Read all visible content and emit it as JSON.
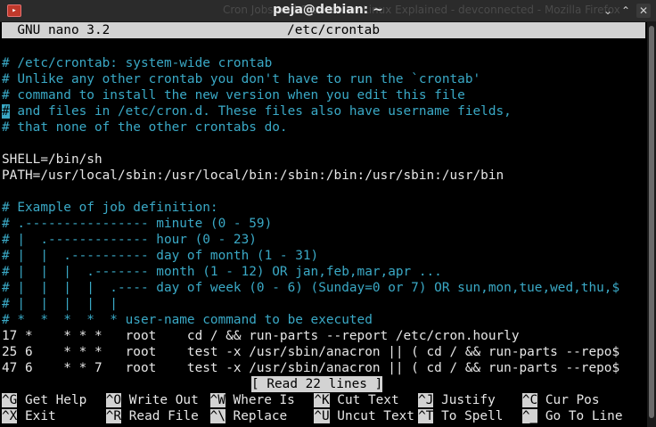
{
  "window": {
    "title": "peja@debian: ~",
    "background_title": "Cron Jobs and Crontab on Linux Explained - devconnected - Mozilla Firefox",
    "buttons": [
      "minimize",
      "maximize",
      "close"
    ]
  },
  "editor": {
    "app_name": "GNU nano 3.2",
    "file_name": "/etc/crontab",
    "status_message": "[ Read 22 lines ]",
    "lines": [
      {
        "text": "",
        "kind": "txt"
      },
      {
        "text": "# /etc/crontab: system-wide crontab",
        "kind": "cmt"
      },
      {
        "text": "# Unlike any other crontab you don't have to run the `crontab'",
        "kind": "cmt"
      },
      {
        "text": "# command to install the new version when you edit this file",
        "kind": "cmt"
      },
      {
        "text": "# and files in /etc/cron.d. These files also have username fields,",
        "kind": "cmt"
      },
      {
        "text": "# that none of the other crontabs do.",
        "kind": "cmt"
      },
      {
        "text": "",
        "kind": "txt"
      },
      {
        "text": "SHELL=/bin/sh",
        "kind": "txt"
      },
      {
        "text": "PATH=/usr/local/sbin:/usr/local/bin:/sbin:/bin:/usr/sbin:/usr/bin",
        "kind": "txt"
      },
      {
        "text": "",
        "kind": "txt"
      },
      {
        "text": "# Example of job definition:",
        "kind": "cmt"
      },
      {
        "text": "# .---------------- minute (0 - 59)",
        "kind": "cmt"
      },
      {
        "text": "# |  .------------- hour (0 - 23)",
        "kind": "cmt"
      },
      {
        "text": "# |  |  .---------- day of month (1 - 31)",
        "kind": "cmt"
      },
      {
        "text": "# |  |  |  .------- month (1 - 12) OR jan,feb,mar,apr ...",
        "kind": "cmt"
      },
      {
        "text": "# |  |  |  |  .---- day of week (0 - 6) (Sunday=0 or 7) OR sun,mon,tue,wed,thu,$",
        "kind": "cmt"
      },
      {
        "text": "# |  |  |  |  |",
        "kind": "cmt"
      },
      {
        "text": "# *  *  *  *  * user-name command to be executed",
        "kind": "cmt"
      },
      {
        "text": "17 *    * * *   root    cd / && run-parts --report /etc/cron.hourly",
        "kind": "txt"
      },
      {
        "text": "25 6    * * *   root    test -x /usr/sbin/anacron || ( cd / && run-parts --repo$",
        "kind": "txt"
      },
      {
        "text": "47 6    * * 7   root    test -x /usr/sbin/anacron || ( cd / && run-parts --repo$",
        "kind": "txt"
      }
    ],
    "cursor": {
      "line": 4,
      "char": "#"
    }
  },
  "shortcuts": [
    [
      {
        "key": "^G",
        "label": "Get Help"
      },
      {
        "key": "^O",
        "label": "Write Out"
      },
      {
        "key": "^W",
        "label": "Where Is"
      },
      {
        "key": "^K",
        "label": "Cut Text"
      },
      {
        "key": "^J",
        "label": "Justify"
      },
      {
        "key": "^C",
        "label": "Cur Pos"
      }
    ],
    [
      {
        "key": "^X",
        "label": "Exit"
      },
      {
        "key": "^R",
        "label": "Read File"
      },
      {
        "key": "^\\",
        "label": "Replace"
      },
      {
        "key": "^U",
        "label": "Uncut Text"
      },
      {
        "key": "^T",
        "label": "To Spell"
      },
      {
        "key": "^_",
        "label": "Go To Line"
      }
    ]
  ],
  "colors": {
    "comment": "#3aa9c6",
    "text": "#e6e6e6",
    "header_bg": "#d3d3d3",
    "background": "#000000"
  }
}
